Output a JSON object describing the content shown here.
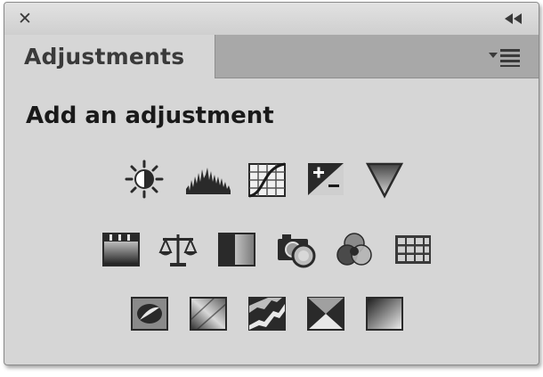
{
  "window": {
    "close_glyph": "✕",
    "collapse_icon": "double-chevron-left-icon"
  },
  "tabs": [
    {
      "label": "Adjustments",
      "active": true
    }
  ],
  "panel_menu_icon": "panel-menu-icon",
  "heading": "Add an adjustment",
  "adjustment_icons": [
    [
      "brightness-contrast-icon",
      "levels-icon",
      "curves-icon",
      "exposure-icon",
      "vibrance-icon"
    ],
    [
      "hue-saturation-icon",
      "color-balance-icon",
      "black-white-icon",
      "photo-filter-icon",
      "channel-mixer-icon",
      "color-lookup-icon"
    ],
    [
      "invert-icon",
      "posterize-icon",
      "threshold-icon",
      "selective-color-icon",
      "gradient-map-icon"
    ]
  ],
  "colors": {
    "panel_bg": "#d6d6d6",
    "tabstrip_bg": "#a8a8a8",
    "text": "#1a1a1a"
  }
}
